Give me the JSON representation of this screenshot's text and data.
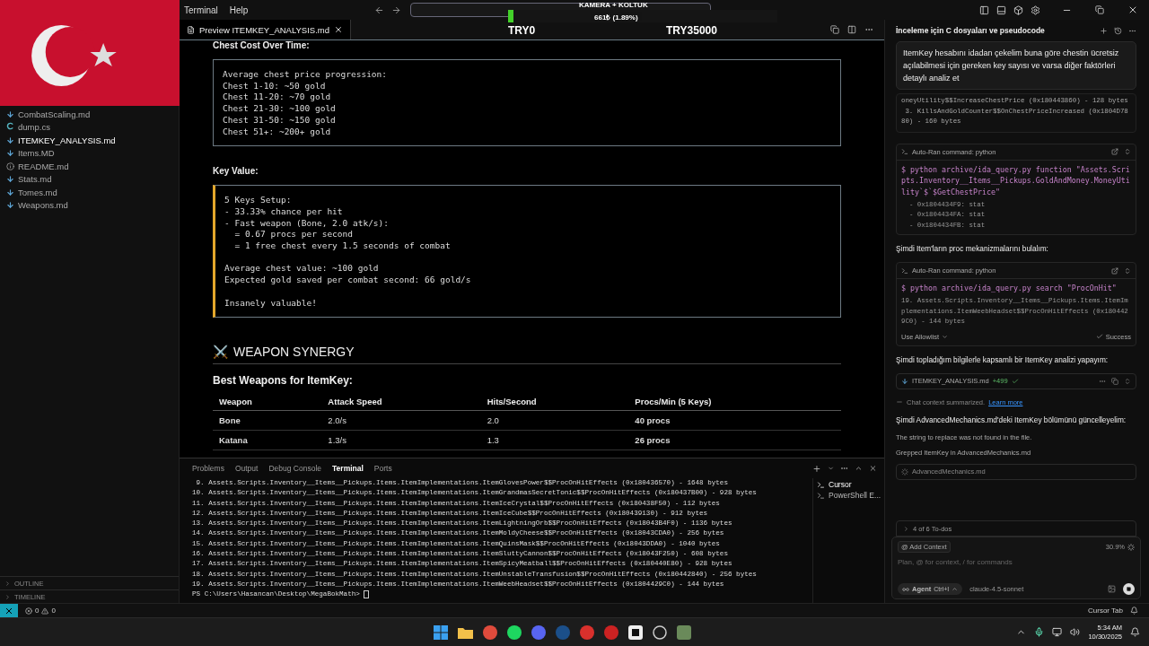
{
  "titlebar": {
    "menu": [
      "Terminal",
      "Help"
    ]
  },
  "stream_overlay": {
    "title": "KAMERA + KOLTUK",
    "amount": "661₺ (1.89%)",
    "goal_start": "TRY0",
    "goal_end": "TRY35000",
    "level": 0.0189
  },
  "sidebar": {
    "files": [
      {
        "name": "CombatScaling.md",
        "kind": "markdown",
        "selected": false
      },
      {
        "name": "dump.cs",
        "kind": "csharp",
        "selected": false
      },
      {
        "name": "ITEMKEY_ANALYSIS.md",
        "kind": "markdown",
        "selected": true
      },
      {
        "name": "Items.MD",
        "kind": "markdown",
        "selected": false
      },
      {
        "name": "README.md",
        "kind": "info",
        "selected": false
      },
      {
        "name": "Stats.md",
        "kind": "markdown",
        "selected": false
      },
      {
        "name": "Tomes.md",
        "kind": "markdown",
        "selected": false
      },
      {
        "name": "Weapons.md",
        "kind": "markdown",
        "selected": false
      }
    ],
    "sections": [
      "OUTLINE",
      "TIMELINE"
    ]
  },
  "editor": {
    "tab": "Preview ITEMKEY_ANALYSIS.md",
    "document": [
      {
        "kind": "h4",
        "text": "Chest Cost Over Time:"
      },
      {
        "kind": "code",
        "accent": false,
        "paragraphs": [
          [
            "Average chest price progression:",
            "Chest 1-10: ~50 gold",
            "Chest 11-20: ~70 gold",
            "Chest 21-30: ~100 gold",
            "Chest 31-50: ~150 gold",
            "Chest 51+: ~200+ gold"
          ]
        ]
      },
      {
        "kind": "h4",
        "text": "Key Value:"
      },
      {
        "kind": "code",
        "accent": true,
        "paragraphs": [
          [
            "5 Keys Setup:",
            "- 33.33% chance per hit",
            "- Fast weapon (Bone, 2.0 atk/s):",
            "  = 0.67 procs per second",
            "  = 1 free chest every 1.5 seconds of combat"
          ],
          [
            "Average chest value: ~100 gold",
            "Expected gold saved per combat second: 66 gold/s"
          ],
          [
            "Insanely valuable!"
          ]
        ]
      },
      {
        "kind": "h2",
        "icon": "⚔️",
        "text": "WEAPON SYNERGY"
      },
      {
        "kind": "h3",
        "text": "Best Weapons for ItemKey:"
      },
      {
        "kind": "table",
        "columns": [
          "Weapon",
          "Attack Speed",
          "Hits/Second",
          "Procs/Min (5 Keys)"
        ],
        "rows": [
          [
            "Bone",
            "2.0/s",
            "2.0",
            "40 procs"
          ],
          [
            "Katana",
            "1.3/s",
            "1.3",
            "26 procs"
          ]
        ]
      }
    ]
  },
  "panel": {
    "tabs": [
      {
        "label": "Problems",
        "selected": false
      },
      {
        "label": "Output",
        "selected": false
      },
      {
        "label": "Debug Console",
        "selected": false
      },
      {
        "label": "Terminal",
        "selected": true
      },
      {
        "label": "Ports",
        "selected": false
      }
    ],
    "lines": [
      " 9. Assets.Scripts.Inventory__Items__Pickups.Items.ItemImplementations.ItemGlovesPower$$ProcOnHitEffects (0x180436570) - 1648 bytes",
      "10. Assets.Scripts.Inventory__Items__Pickups.Items.ItemImplementations.ItemGrandmasSecretTonic$$ProcOnHitEffects (0x180437B00) - 928 bytes",
      "11. Assets.Scripts.Inventory__Items__Pickups.Items.ItemImplementations.ItemIceCrystal$$ProcOnHitEffects (0x180438F50) - 112 bytes",
      "12. Assets.Scripts.Inventory__Items__Pickups.Items.ItemImplementations.ItemIceCube$$ProcOnHitEffects (0x180439130) - 912 bytes",
      "13. Assets.Scripts.Inventory__Items__Pickups.Items.ItemImplementations.ItemLightningOrb$$ProcOnHitEffects (0x18043B4F0) - 1136 bytes",
      "14. Assets.Scripts.Inventory__Items__Pickups.Items.ItemImplementations.ItemMoldyCheese$$ProcOnHitEffects (0x18043CDA0) - 256 bytes",
      "15. Assets.Scripts.Inventory__Items__Pickups.Items.ItemImplementations.ItemQuinsMask$$ProcOnHitEffects (0x18043DDA0) - 1040 bytes",
      "16. Assets.Scripts.Inventory__Items__Pickups.Items.ItemImplementations.ItemSluttyCannon$$ProcOnHitEffects (0x18043F250) - 608 bytes",
      "17. Assets.Scripts.Inventory__Items__Pickups.Items.ItemImplementations.ItemSpicyMeatball$$ProcOnHitEffects (0x180440E80) - 928 bytes",
      "18. Assets.Scripts.Inventory__Items__Pickups.Items.ItemImplementations.ItemUnstableTransfusion$$ProcOnHitEffects (0x180442840) - 256 bytes",
      "19. Assets.Scripts.Inventory__Items__Pickups.Items.ItemImplementations.ItemWeebHeadset$$ProcOnHitEffects (0x1804429C0) - 144 bytes"
    ],
    "prompt": "PS C:\\Users\\Hasancan\\Desktop\\MegaBokMath> ",
    "terminals": [
      {
        "name": "Cursor",
        "selected": true
      },
      {
        "name": "PowerShell E...",
        "selected": false
      }
    ]
  },
  "chat": {
    "title": "İnceleme için C dosyaları ve pseudocode",
    "user_message": "ItemKey hesabını idadan çekelim buna göre chestin ücretsiz açılabilmesi için gereken key sayısı ve varsa diğer faktörleri detaylı analiz et",
    "items": [
      {
        "kind": "output",
        "lines": [
          "oneyUtility$$IncreaseChestPrice (0x180443860) - 128 bytes",
          " 3. KillsAndGoldCounter$$OnChestPriceIncreased (0x1804D7880) - 160 bytes"
        ]
      },
      {
        "kind": "command",
        "label": "Auto-Ran command: python",
        "command": "$ python archive/ida_query.py function \"Assets.Scripts.Inventory__Items__Pickups.GoldAndMoney.MoneyUtility`$`$GetChestPrice\"",
        "output": [
          "  - 0x1804434F9: stat",
          "  - 0x1804434FA: stat",
          "  - 0x1804434FB: stat"
        ]
      },
      {
        "kind": "text",
        "text": "Şimdi Item'ların proc mekanizmalarını bulalım:"
      },
      {
        "kind": "command",
        "label": "Auto-Ran command: python",
        "command": "$ python archive/ida_query.py search \"ProcOnHit\"",
        "output": [
          "19. Assets.Scripts.Inventory__Items__Pickups.Items.ItemImplementations.ItemWeebHeadset$$ProcOnHitEffects (0x1804429C0) - 144 bytes"
        ],
        "allowlist": "Use Allowlist",
        "status": "Success"
      },
      {
        "kind": "text",
        "text": "Şimdi topladığım bilgilerle kapsamlı bir ItemKey analizi yapayım:"
      },
      {
        "kind": "file",
        "name": "ITEMKEY_ANALYSIS.md",
        "added": "+499"
      },
      {
        "kind": "note",
        "text": "Chat context summarized.",
        "link": "Learn more"
      },
      {
        "kind": "text",
        "text": "Şimdi AdvancedMechanics.md'deki ItemKey bölümünü güncelleyelim:"
      },
      {
        "kind": "muted",
        "text": "The string to replace was not found in the file."
      },
      {
        "kind": "muted",
        "text": "Grepped ItemKey in AdvancedMechanics.md"
      },
      {
        "kind": "loading",
        "text": "AdvancedMechanics.md"
      }
    ],
    "todos": "4 of 6 To-dos",
    "input": {
      "context_button": "@ Add Context",
      "usage": "30.9%",
      "placeholder": "Plan, @ for context, / for commands",
      "mode": "Agent",
      "shortcut": "Ctrl+I",
      "model": "claude-4.5-sonnet"
    }
  },
  "status_bar": {
    "errors": "0",
    "warnings": "0",
    "right": "Cursor Tab"
  },
  "taskbar": {
    "time": "5:34 AM",
    "date": "10/30/2025"
  }
}
